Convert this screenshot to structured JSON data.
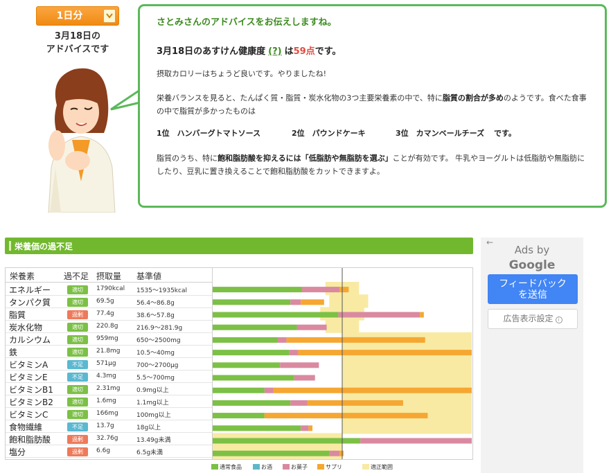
{
  "period": {
    "label": "1日分"
  },
  "caption": {
    "line1": "3月18日の",
    "line2": "アドバイスです"
  },
  "advice": {
    "greeting": "さとみさんのアドバイスをお伝えしますね。",
    "score_prefix": "3月18日のあすけん健康度",
    "help_link": "(?)",
    "score_mid": "は",
    "score_value": "59点",
    "score_suffix": "です。",
    "calorie_text": "摂取カロリーはちょうど良いです。やりましたね!",
    "balance_text_1": "栄養バランスを見ると、たんぱく質・脂質・炭水化物の3つ主要栄養素の中で、特に",
    "balance_bold": "脂質の割合が多め",
    "balance_text_2": "のようです。食べた食事の中で脂質が多かったものは",
    "ranking": [
      "1位　ハンバーグトマトソース",
      "2位　パウンドケーキ",
      "3位　カマンベールチーズ"
    ],
    "ranking_suffix": "です。",
    "fat_text_1": "脂質のうち、特に",
    "fat_bold_1": "飽和脂肪酸を抑えるには「低脂肪や無脂肪を選ぶ」",
    "fat_text_2": "ことが有効です。 牛乳やヨーグルトは低脂肪や無脂肪にしたり、豆乳に置き換えることで飽和脂肪酸をカットできますよ。"
  },
  "nutrition": {
    "title": "栄養価の過不足",
    "headers": {
      "name": "栄養素",
      "status": "過不足",
      "intake": "摂取量",
      "standard": "基準値"
    },
    "rows": [
      {
        "name": "エネルギー",
        "status": "適切",
        "intake": "1790kcal",
        "standard": "1535～1935kcal"
      },
      {
        "name": "タンパク質",
        "status": "適切",
        "intake": "69.5g",
        "standard": "56.4～86.8g"
      },
      {
        "name": "脂質",
        "status": "過剰",
        "intake": "77.4g",
        "standard": "38.6～57.8g"
      },
      {
        "name": "炭水化物",
        "status": "適切",
        "intake": "220.8g",
        "standard": "216.9～281.9g"
      },
      {
        "name": "カルシウム",
        "status": "適切",
        "intake": "959mg",
        "standard": "650～2500mg"
      },
      {
        "name": "鉄",
        "status": "適切",
        "intake": "21.8mg",
        "standard": "10.5～40mg"
      },
      {
        "name": "ビタミンA",
        "status": "不足",
        "intake": "571μg",
        "standard": "700～2700μg"
      },
      {
        "name": "ビタミンE",
        "status": "不足",
        "intake": "4.3mg",
        "standard": "5.5～700mg"
      },
      {
        "name": "ビタミンB1",
        "status": "適切",
        "intake": "2.31mg",
        "standard": "0.9mg以上"
      },
      {
        "name": "ビタミンB2",
        "status": "適切",
        "intake": "1.6mg",
        "standard": "1.1mg以上"
      },
      {
        "name": "ビタミンC",
        "status": "適切",
        "intake": "166mg",
        "standard": "100mg以上"
      },
      {
        "name": "食物繊維",
        "status": "不足",
        "intake": "13.7g",
        "standard": "18g以上"
      },
      {
        "name": "飽和脂肪酸",
        "status": "過剰",
        "intake": "32.76g",
        "standard": "13.49g未満"
      },
      {
        "name": "塩分",
        "status": "過剰",
        "intake": "6.6g",
        "standard": "6.5g未満"
      }
    ],
    "status_colors": {
      "適切": "#7cc046",
      "過剰": "#ee7a5a",
      "不足": "#5bb8d0"
    },
    "legend": [
      {
        "label": "通常食品",
        "color": "#7cc046"
      },
      {
        "label": "お酒",
        "color": "#60b7c9"
      },
      {
        "label": "お菓子",
        "color": "#d98aa0"
      },
      {
        "label": "サプリ",
        "color": "#f5a732"
      },
      {
        "label": "適正範囲",
        "color": "#f8eaa3"
      }
    ]
  },
  "chart_data": {
    "type": "bar",
    "stacked": true,
    "orientation": "horizontal",
    "unit": "% of standard",
    "categories": [
      "エネルギー",
      "タンパク質",
      "脂質",
      "炭水化物",
      "カルシウム",
      "鉄",
      "ビタミンA",
      "ビタミンE",
      "ビタミンB1",
      "ビタミンB2",
      "ビタミンC",
      "食物繊維",
      "飽和脂肪酸",
      "塩分"
    ],
    "series": [
      {
        "name": "通常食品",
        "values": [
          69,
          60,
          97,
          65,
          50,
          59,
          52,
          63,
          40,
          60,
          40,
          68,
          114,
          90
        ]
      },
      {
        "name": "お酒",
        "values": [
          0,
          0,
          0,
          0,
          0,
          0,
          0,
          0,
          0,
          0,
          0,
          0,
          0,
          0
        ]
      },
      {
        "name": "お菓子",
        "values": [
          29,
          8,
          63,
          23,
          7,
          7,
          30,
          16,
          7,
          13,
          0,
          6,
          86,
          8
        ]
      },
      {
        "name": "サプリ",
        "values": [
          7,
          18,
          3,
          0,
          107,
          134,
          0,
          0,
          153,
          74,
          126,
          3,
          0,
          3
        ]
      }
    ],
    "range_low": [
      87,
      90,
      83,
      87,
      100,
      100,
      100,
      100,
      100,
      100,
      100,
      100,
      0,
      0
    ],
    "range_high": [
      113,
      120,
      117,
      113,
      200,
      200,
      200,
      200,
      200,
      200,
      200,
      200,
      100,
      100
    ],
    "xlim": [
      0,
      200
    ],
    "reference_line": 100
  },
  "ads": {
    "back_arrow": "←",
    "title_1": "Ads by",
    "title_2": "Google",
    "feedback_1": "フィードバック",
    "feedback_2": "を送信",
    "settings": "広告表示設定",
    "info": "i"
  }
}
